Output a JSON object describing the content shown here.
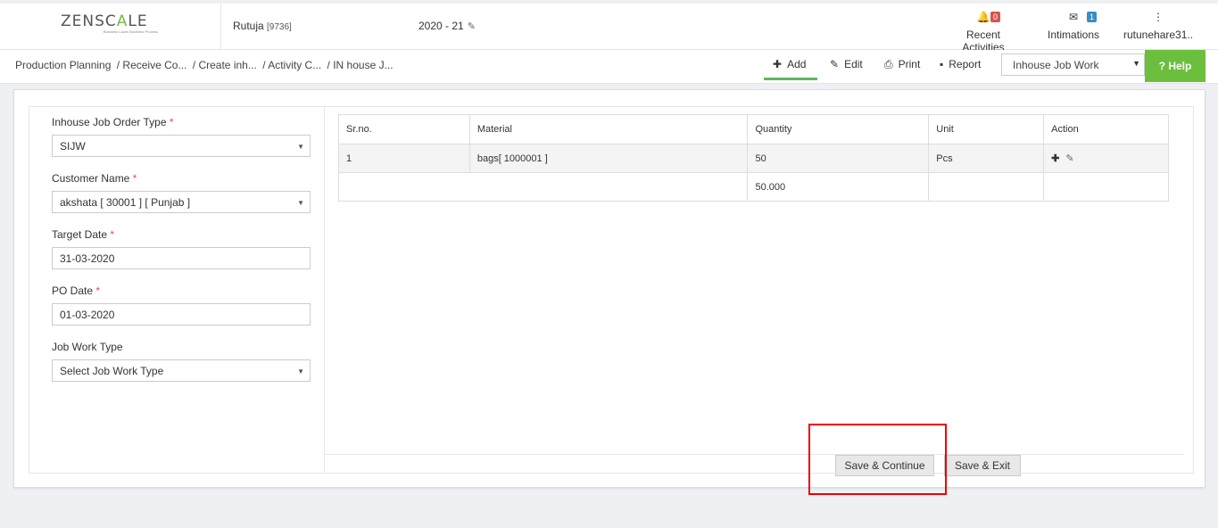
{
  "header": {
    "logo_main_a": "ZENSC",
    "logo_main_b": "A",
    "logo_main_c": "LE",
    "logo_sub": "Business Laces Business Process",
    "user_name": "Rutuja ",
    "user_code": "[9736]",
    "financial_year": "2020 - 21",
    "recent_activities_label": "Recent Activities",
    "recent_activities_count": "0",
    "intimations_label": "Intimations",
    "intimations_count": "1",
    "username": "rutunehare31.."
  },
  "breadcrumb": [
    "Production Planning ",
    "/ Receive Co...",
    "/ Create inh...",
    "/ Activity C...",
    "/ IN house J..."
  ],
  "toolbar": {
    "add": "Add",
    "edit": "Edit",
    "print": "Print",
    "report": "Report",
    "module_selected": "Inhouse Job Work",
    "help": "Help"
  },
  "form": {
    "order_type_label": "Inhouse Job Order Type",
    "order_type_value": "SIJW",
    "customer_label": "Customer Name",
    "customer_value": "akshata [ 30001 ] [ Punjab ]",
    "target_date_label": "Target Date",
    "target_date_value": "31-03-2020",
    "po_date_label": "PO Date",
    "po_date_value": "01-03-2020",
    "job_work_type_label": "Job Work Type",
    "job_work_type_value": "Select Job Work Type",
    "required_mark": "*"
  },
  "table": {
    "headers": [
      "Sr.no.",
      "Material",
      "Quantity",
      "Unit",
      "Action"
    ],
    "rows": [
      {
        "srno": "1",
        "material": "bags[ 1000001 ]",
        "quantity": "50",
        "unit": "Pcs"
      }
    ],
    "total_quantity": "50.000"
  },
  "buttons": {
    "save_continue": "Save & Continue",
    "save_exit": "Save & Exit"
  },
  "colors": {
    "accent_green": "#6cbf3d",
    "highlight_red": "#ee0000",
    "required_red": "#d9534f"
  }
}
